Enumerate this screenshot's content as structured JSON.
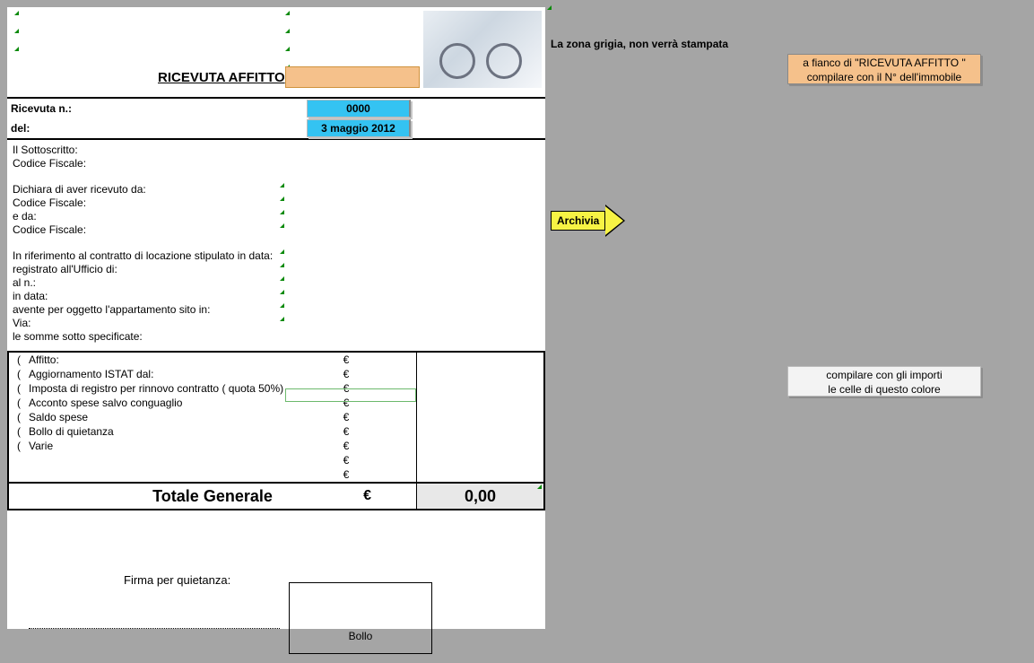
{
  "header": {
    "title": "RICEVUTA AFFITTO"
  },
  "info": {
    "receipt_label": "Ricevuta n.:",
    "receipt_value": "0000",
    "date_label": "del:",
    "date_value": "3 maggio 2012"
  },
  "details": {
    "sottoscritto": "Il Sottoscritto:",
    "cf1": "Codice Fiscale:",
    "dichiara": "Dichiara di aver ricevuto da:",
    "cf2": "Codice Fiscale:",
    "eda": "e da:",
    "cf3": "Codice Fiscale:",
    "contratto": "In riferimento al contratto di locazione stipulato in data:",
    "registrato": "registrato all'Ufficio di:",
    "aln": "al n.:",
    "indata": "in data:",
    "oggetto": "avente per oggetto l'appartamento sito in:",
    "via": "Via:",
    "somme": "le somme sotto specificate:"
  },
  "items": [
    {
      "label": "Affitto:",
      "eur": "€"
    },
    {
      "label": "Aggiornamento ISTAT dal:",
      "eur": "€"
    },
    {
      "label": "Imposta di registro per rinnovo contratto ( quota 50%)",
      "eur": "€"
    },
    {
      "label": "Acconto spese salvo conguaglio",
      "eur": "€"
    },
    {
      "label": "Saldo spese",
      "eur": "€"
    },
    {
      "label": "Bollo di quietanza",
      "eur": "€"
    },
    {
      "label": "Varie",
      "eur": "€"
    },
    {
      "label": "",
      "eur": "€"
    },
    {
      "label": "",
      "eur": "€"
    }
  ],
  "totals": {
    "label": "Totale Generale",
    "eur": "€",
    "value": "0,00"
  },
  "footer": {
    "signature_label": "Firma per quietanza:",
    "bollo_label": "Bollo"
  },
  "sidebar": {
    "gray_note": "La zona grigia, non verrà stampata",
    "tip1_line1": "a fianco di \"RICEVUTA AFFITTO \"",
    "tip1_line2": "compilare con il N° dell'immobile",
    "tip2_line1": "compilare con gli importi",
    "tip2_line2": "le celle di questo colore",
    "archive_button": "Archivia"
  }
}
